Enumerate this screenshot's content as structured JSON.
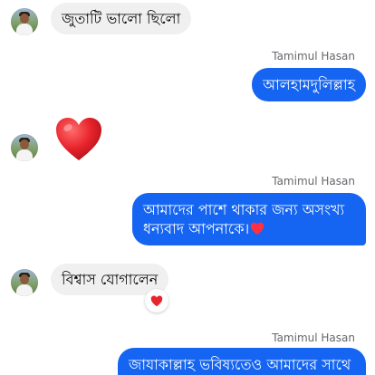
{
  "messages": [
    {
      "text": "জুতাটি ভালো ছিলো"
    },
    {
      "sender": "Tamimul Hasan",
      "text": "আলহামদুলিল্লাহ"
    },
    {
      "emoji": "heart-emoji"
    },
    {
      "sender": "Tamimul Hasan",
      "line1": "আমাদের পাশে থাকার জন্য অসংখ্য",
      "line2": "ধন্যবাদ আপনাকে।",
      "emoji": "heart-emoji"
    },
    {
      "text": "বিশ্বাস যোগালেন",
      "reaction": "heart-icon"
    },
    {
      "sender": "Tamimul Hasan",
      "text": "জাযাকাল্লাহ ভবিষ্যতেও আমাদের সাথে"
    }
  ],
  "colors": {
    "outgoing_bubble": "#1565f2",
    "incoming_bubble": "#f0f0f0",
    "heart": "#e8242c"
  }
}
